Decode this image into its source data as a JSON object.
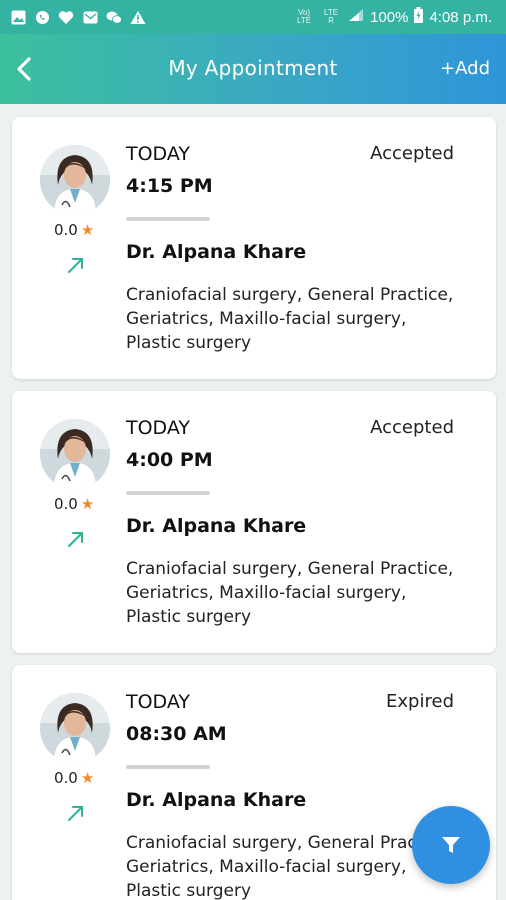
{
  "status_bar": {
    "network_small": "Vo) LTE",
    "network_small2": "LTE R",
    "battery": "100%",
    "time": "4:08 p.m."
  },
  "header": {
    "title": "My Appointment",
    "add_label": "+Add"
  },
  "appointments": [
    {
      "day": "TODAY",
      "time": "4:15 PM",
      "status": "Accepted",
      "rating": "0.0",
      "doctor": "Dr. Alpana Khare",
      "specialties": "Craniofacial surgery, General Practice, Geriatrics, Maxillo-facial surgery, Plastic surgery"
    },
    {
      "day": "TODAY",
      "time": "4:00 PM",
      "status": "Accepted",
      "rating": "0.0",
      "doctor": "Dr. Alpana Khare",
      "specialties": "Craniofacial surgery, General Practice, Geriatrics, Maxillo-facial surgery, Plastic surgery"
    },
    {
      "day": "TODAY",
      "time": "08:30 AM",
      "status": "Expired",
      "rating": "0.0",
      "doctor": "Dr. Alpana Khare",
      "specialties": "Craniofacial surgery, General Practice, Geriatrics, Maxillo-facial surgery, Plastic surgery"
    }
  ],
  "colors": {
    "status_bar": "#34b3a3",
    "header_start": "#3cc09c",
    "header_end": "#2f95d8",
    "star": "#f08a2c",
    "trend_arrow": "#2bb596",
    "fab": "#2f8fe0"
  },
  "icons": {
    "back": "chevron-left-icon",
    "filter": "filter-icon",
    "trend": "trending-up-icon",
    "star": "star-icon"
  }
}
